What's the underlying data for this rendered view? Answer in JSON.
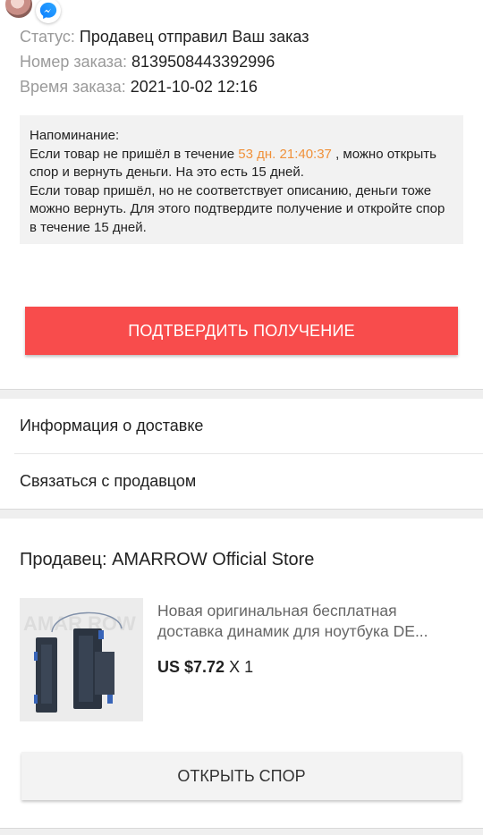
{
  "order": {
    "status_label": "Статус:",
    "status_value": "Продавец отправил Ваш заказ",
    "number_label": "Номер заказа:",
    "number_value": "8139508443392996",
    "time_label": "Время заказа:",
    "time_value": "2021-10-02 12:16"
  },
  "reminder": {
    "title": "Напоминание:",
    "line1_before": "Если товар не пришёл в течение ",
    "timer": "53 дн. 21:40:37",
    "line1_after": " , можно открыть спор и вернуть деньги. На это есть 15 дней.",
    "line2": "Если товар пришёл, но не соответствует описанию, деньги тоже можно вернуть. Для этого подтвердите получение и откройте спор в течение 15 дней."
  },
  "actions": {
    "confirm_label": "ПОДТВЕРДИТЬ ПОЛУЧЕНИЕ",
    "dispute_label": "ОТКРЫТЬ СПОР"
  },
  "menu": {
    "delivery_info": "Информация о доставке",
    "contact_seller": "Связаться с продавцом"
  },
  "seller": {
    "label": "Продавец: AMARROW Official Store"
  },
  "product": {
    "title": "Новая оригинальная бесплатная доставка динамик для ноутбука DE...",
    "price": "US $7.72",
    "quantity": " X 1"
  },
  "colors": {
    "accent_red": "#f84c4c",
    "timer_orange": "#f0913a"
  },
  "icons": {
    "chat_avatar": "avatar",
    "messenger": "messenger-icon"
  }
}
